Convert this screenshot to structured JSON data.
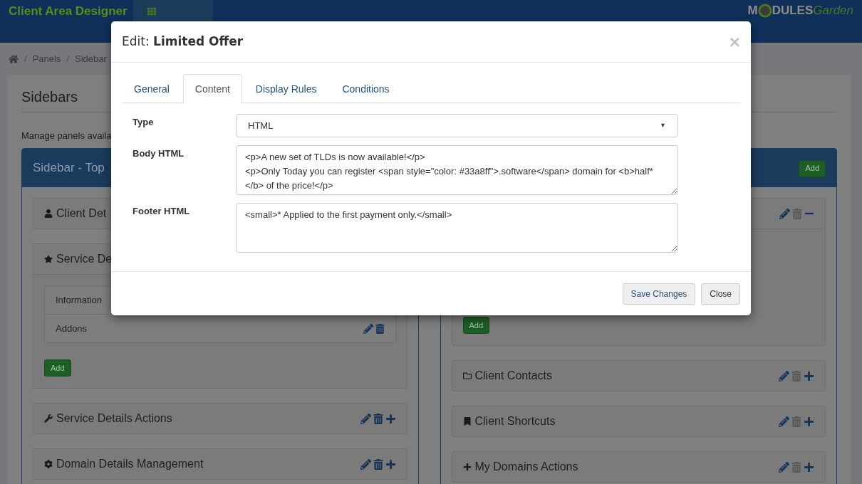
{
  "header": {
    "brand": "Client Area Designer",
    "logo": [
      "M",
      "DULES",
      "Garden"
    ]
  },
  "breadcrumb": [
    {
      "separator": "/",
      "label": "Panels"
    },
    {
      "separator": "/",
      "label": "Sidebar"
    }
  ],
  "page": {
    "title": "Sidebars",
    "description": "Manage panels availa"
  },
  "columns": [
    {
      "title": "Sidebar - Top",
      "panels": [
        {
          "title": "Client Det",
          "expanded": false
        },
        {
          "title": "Service De",
          "expanded": true,
          "items": [
            "Information",
            "Addons"
          ],
          "add_label": "Add"
        },
        {
          "title": "Service Details Actions",
          "expanded": false
        },
        {
          "title": "Domain Details Management",
          "expanded": false
        }
      ]
    },
    {
      "add_label": "Add",
      "panels": [
        {
          "expanded": true,
          "add_label": "Add"
        },
        {
          "title": "Client Contacts",
          "expanded": false
        },
        {
          "title": "Client Shortcuts",
          "expanded": false
        },
        {
          "title": "My Domains Actions",
          "expanded": false
        }
      ]
    }
  ],
  "modal": {
    "title_prefix": "Edit:",
    "title": "Limited Offer",
    "close": "×",
    "tabs": [
      {
        "label": "General",
        "selected": false
      },
      {
        "label": "Content",
        "selected": true
      },
      {
        "label": "Display Rules",
        "selected": false
      },
      {
        "label": "Conditions",
        "selected": false
      }
    ],
    "fields": [
      {
        "kind": "select",
        "label": "Type",
        "value": "HTML",
        "caret": "▼"
      },
      {
        "kind": "textarea",
        "label": "Body HTML",
        "value": "<p>A new set of TLDs is now available!</p>\n<p>Only Today you can register <span style=\"color: #33a8ff\">.software</span> domain for <b>half*</b> of the price!</p>"
      },
      {
        "kind": "textarea",
        "label": "Footer HTML",
        "value": "<small>* Applied to the first payment only.</small>"
      }
    ],
    "buttons": [
      {
        "label": "Save Changes",
        "kind": "primary"
      },
      {
        "label": "Close",
        "kind": "default"
      }
    ]
  }
}
